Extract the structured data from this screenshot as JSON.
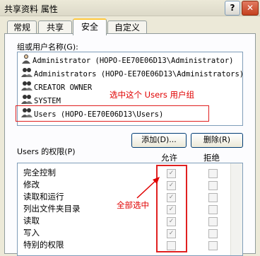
{
  "window": {
    "title": "共享资料 属性",
    "help_glyph": "?",
    "close_glyph": "✕"
  },
  "tabs": [
    {
      "label": "常规"
    },
    {
      "label": "共享"
    },
    {
      "label": "安全"
    },
    {
      "label": "自定义"
    }
  ],
  "active_tab": "安全",
  "users_label": "组或用户名称(G):",
  "users": [
    {
      "name": "Administrator (HOPO-EE70E06D13\\Administrator)"
    },
    {
      "name": "Administrators (HOPO-EE70E06D13\\Administrators)"
    },
    {
      "name": "CREATOR OWNER"
    },
    {
      "name": "SYSTEM"
    },
    {
      "name": "Users (HOPO-EE70E06D13\\Users)"
    }
  ],
  "annotations": {
    "select_group": "选中这个 Users 用户组",
    "check_all": "全部选中"
  },
  "buttons": {
    "add": "添加(D)...",
    "remove": "删除(R)"
  },
  "permissions_label": "Users 的权限(P)",
  "columns": {
    "allow": "允许",
    "deny": "拒绝"
  },
  "permissions": [
    {
      "name": "完全控制",
      "allow": true,
      "deny": false
    },
    {
      "name": "修改",
      "allow": true,
      "deny": false
    },
    {
      "name": "读取和运行",
      "allow": true,
      "deny": false
    },
    {
      "name": "列出文件夹目录",
      "allow": true,
      "deny": false
    },
    {
      "name": "读取",
      "allow": true,
      "deny": false
    },
    {
      "name": "写入",
      "allow": true,
      "deny": false
    },
    {
      "name": "特别的权限",
      "allow": false,
      "deny": false
    }
  ],
  "colors": {
    "annotation": "#e00000",
    "selection_border": "#e02020"
  }
}
